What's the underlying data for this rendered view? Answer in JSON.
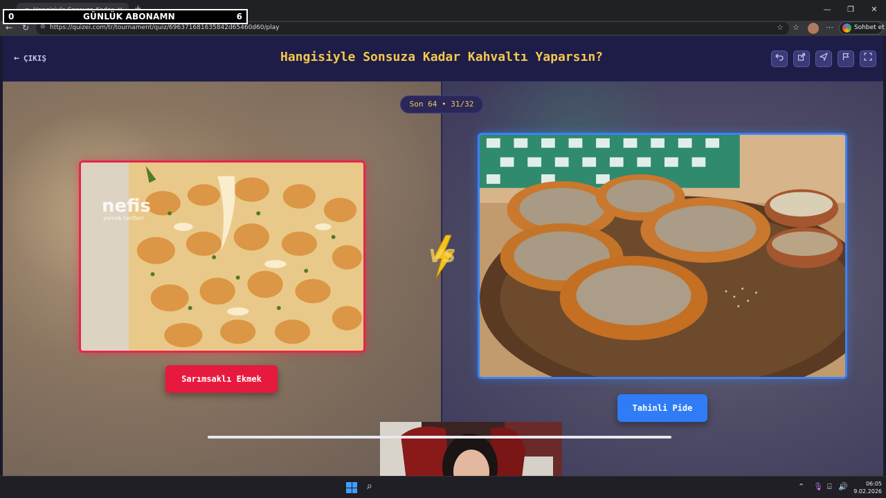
{
  "browser": {
    "tab_title": "Hangisiyle Sonsuza Kadar Kahvaltı...",
    "url": "https://quizei.com/tr/tournament/quiz/696371681635842d65460d60/play",
    "chat_button": "Sohbet et",
    "window_controls": [
      "—",
      "❒",
      "✕"
    ]
  },
  "overlay": {
    "sub_left": "0",
    "sub_label": "GÜNLÜK ABONAMN",
    "sub_right": "6"
  },
  "header": {
    "exit_label": "ÇIKIŞ",
    "title": "Hangisiyle Sonsuza Kadar Kahvaltı Yaparsın?"
  },
  "round": {
    "label": "Son 64 • 31/32"
  },
  "choices": {
    "left_label": "Sarımsaklı Ekmek",
    "right_label": "Tahinli Pide"
  },
  "left_image": {
    "watermark": "nefis",
    "watermark_sub": "yemek tarifleri"
  },
  "vs_text": "VS",
  "taskbar": {
    "time": "06:05",
    "date": "9.02.2026"
  },
  "colors": {
    "title": "#f5c84c",
    "left_accent": "#e8193f",
    "right_accent": "#2f7cf6"
  }
}
